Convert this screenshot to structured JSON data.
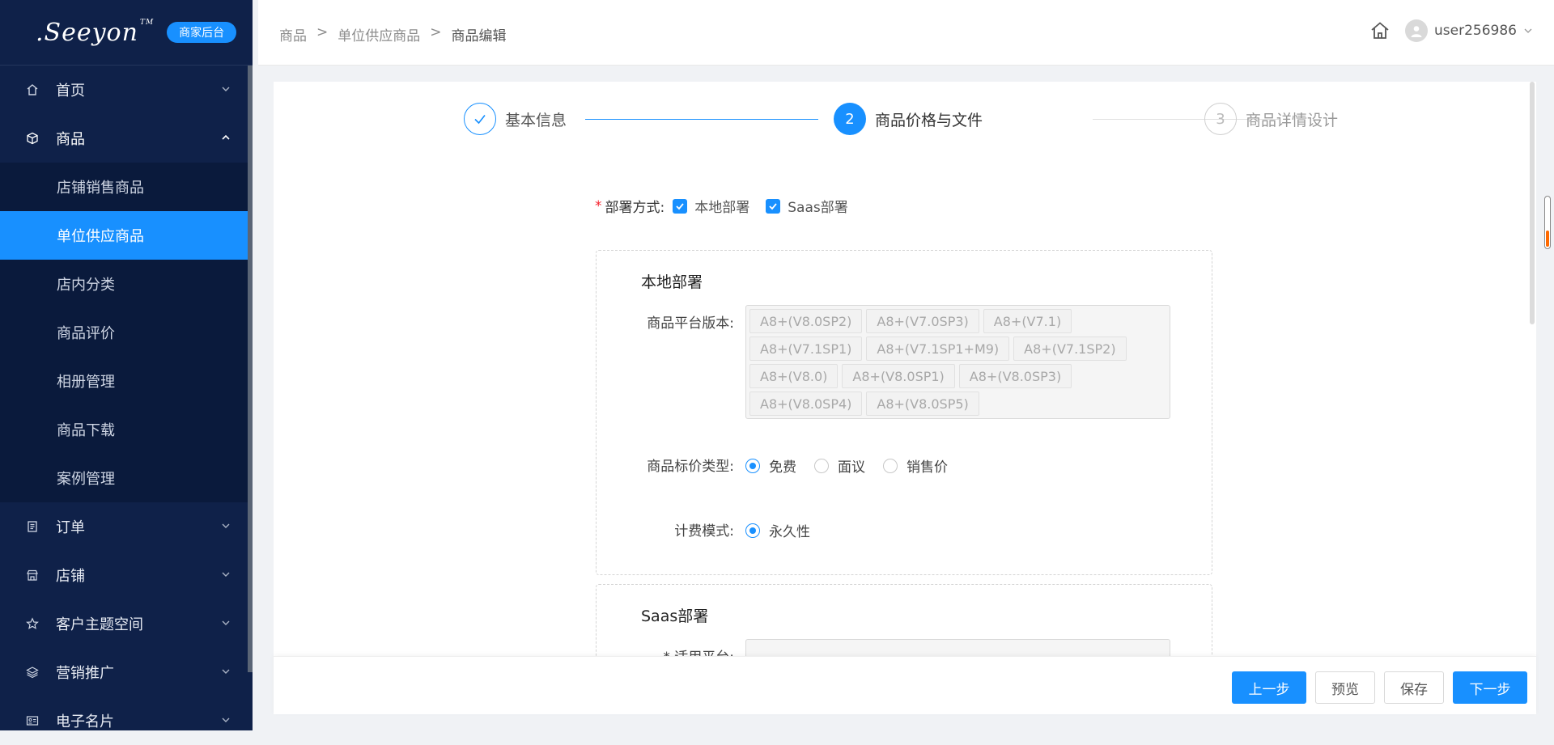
{
  "logo": {
    "text": ".Seeyon",
    "tm": "TM",
    "badge": "商家后台"
  },
  "sidebar": {
    "items": [
      {
        "label": "首页",
        "icon": "home-icon"
      },
      {
        "label": "商品",
        "icon": "box-icon"
      },
      {
        "label": "订单",
        "icon": "order-icon"
      },
      {
        "label": "店铺",
        "icon": "store-icon"
      },
      {
        "label": "客户主题空间",
        "icon": "star-icon"
      },
      {
        "label": "营销推广",
        "icon": "layers-icon"
      },
      {
        "label": "电子名片",
        "icon": "card-icon"
      }
    ],
    "sub_items": [
      "店铺销售商品",
      "单位供应商品",
      "店内分类",
      "商品评价",
      "相册管理",
      "商品下载",
      "案例管理"
    ],
    "active_sub": "单位供应商品"
  },
  "header": {
    "breadcrumbs": [
      "商品",
      "单位供应商品",
      "商品编辑"
    ],
    "separator": ">",
    "username": "user256986"
  },
  "steps": [
    {
      "num": "✓",
      "label": "基本信息",
      "state": "done"
    },
    {
      "num": "2",
      "label": "商品价格与文件",
      "state": "current"
    },
    {
      "num": "3",
      "label": "商品详情设计",
      "state": "pending"
    }
  ],
  "deploy": {
    "label": "部署方式:",
    "required_mark": "*",
    "options": [
      {
        "label": "本地部署",
        "checked": true
      },
      {
        "label": "Saas部署",
        "checked": true
      }
    ]
  },
  "local_panel": {
    "title": "本地部署",
    "version_label": "商品平台版本:",
    "versions": [
      "A8+(V8.0SP2)",
      "A8+(V7.0SP3)",
      "A8+(V7.1)",
      "A8+(V7.1SP1)",
      "A8+(V7.1SP1+M9)",
      "A8+(V7.1SP2)",
      "A8+(V8.0)",
      "A8+(V8.0SP1)",
      "A8+(V8.0SP3)",
      "A8+(V8.0SP4)",
      "A8+(V8.0SP5)"
    ],
    "price_label": "商品标价类型:",
    "price_options": [
      "免费",
      "面议",
      "销售价"
    ],
    "price_selected": "免费",
    "billing_label": "计费模式:",
    "billing_options": [
      "永久性"
    ],
    "billing_selected": "永久性"
  },
  "saas_panel": {
    "title": "Saas部署",
    "platform_label": "* 适用平台:"
  },
  "footer": {
    "prev": "上一步",
    "preview": "预览",
    "save": "保存",
    "next": "下一步"
  },
  "colors": {
    "sidebar_bg": "#0f2149",
    "accent": "#1890ff",
    "required": "#f5222d"
  }
}
